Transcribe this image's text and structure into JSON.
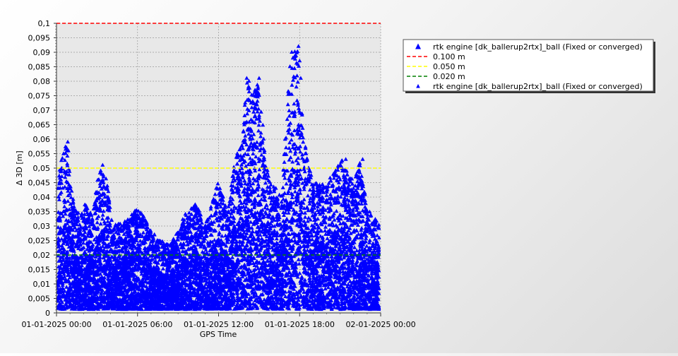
{
  "chart_data": {
    "type": "scatter",
    "xlabel": "GPS Time",
    "ylabel": "Δ 3D [m]",
    "x_range": [
      "2025-01-01T00:00",
      "2025-01-02T00:00"
    ],
    "ylim": [
      0,
      0.1
    ],
    "y_ticks": [
      "0",
      "0,005",
      "0,01",
      "0,015",
      "0,02",
      "0,025",
      "0,03",
      "0,035",
      "0,04",
      "0,045",
      "0,05",
      "0,055",
      "0,06",
      "0,065",
      "0,07",
      "0,075",
      "0,08",
      "0,085",
      "0,09",
      "0,095",
      "0,1"
    ],
    "x_ticks": [
      {
        "value": "2025-01-01T00:00",
        "label": "01-01-2025 00:00"
      },
      {
        "value": "2025-01-01T06:00",
        "label": "01-01-2025 06:00"
      },
      {
        "value": "2025-01-01T12:00",
        "label": "01-01-2025 12:00"
      },
      {
        "value": "2025-01-01T18:00",
        "label": "01-01-2025 18:00"
      },
      {
        "value": "2025-01-02T00:00",
        "label": "02-01-2025 00:00"
      }
    ],
    "grid": true,
    "legend_position": "right",
    "reference_lines": [
      {
        "name": "0.100 m",
        "y": 0.1,
        "color": "#ff0000",
        "style": "dashed"
      },
      {
        "name": "0.050 m",
        "y": 0.05,
        "color": "#ffff00",
        "style": "dashed"
      },
      {
        "name": "0.020 m",
        "y": 0.02,
        "color": "#008000",
        "style": "dashed"
      }
    ],
    "series": [
      {
        "name": "rtk engine [dk_ballerup2rtx]_ball (Fixed or converged)",
        "color": "#0000ff",
        "marker": "triangle",
        "envelope": [
          {
            "x": "2025-01-01T00:00",
            "y": 0.04
          },
          {
            "x": "2025-01-01T00:10",
            "y": 0.047
          },
          {
            "x": "2025-01-01T00:25",
            "y": 0.056
          },
          {
            "x": "2025-01-01T00:50",
            "y": 0.059
          },
          {
            "x": "2025-01-01T01:10",
            "y": 0.04
          },
          {
            "x": "2025-01-01T01:40",
            "y": 0.034
          },
          {
            "x": "2025-01-01T02:10",
            "y": 0.038
          },
          {
            "x": "2025-01-01T02:40",
            "y": 0.033
          },
          {
            "x": "2025-01-01T03:00",
            "y": 0.046
          },
          {
            "x": "2025-01-01T03:25",
            "y": 0.051
          },
          {
            "x": "2025-01-01T03:45",
            "y": 0.045
          },
          {
            "x": "2025-01-01T04:10",
            "y": 0.03
          },
          {
            "x": "2025-01-01T05:00",
            "y": 0.032
          },
          {
            "x": "2025-01-01T06:00",
            "y": 0.036
          },
          {
            "x": "2025-01-01T06:40",
            "y": 0.032
          },
          {
            "x": "2025-01-01T07:30",
            "y": 0.025
          },
          {
            "x": "2025-01-01T08:30",
            "y": 0.024
          },
          {
            "x": "2025-01-01T09:30",
            "y": 0.034
          },
          {
            "x": "2025-01-01T10:20",
            "y": 0.038
          },
          {
            "x": "2025-01-01T11:00",
            "y": 0.03
          },
          {
            "x": "2025-01-01T12:00",
            "y": 0.046
          },
          {
            "x": "2025-01-01T12:40",
            "y": 0.035
          },
          {
            "x": "2025-01-01T13:10",
            "y": 0.052
          },
          {
            "x": "2025-01-01T13:45",
            "y": 0.06
          },
          {
            "x": "2025-01-01T14:05",
            "y": 0.081
          },
          {
            "x": "2025-01-01T14:30",
            "y": 0.075
          },
          {
            "x": "2025-01-01T15:00",
            "y": 0.081
          },
          {
            "x": "2025-01-01T15:30",
            "y": 0.052
          },
          {
            "x": "2025-01-01T16:00",
            "y": 0.044
          },
          {
            "x": "2025-01-01T16:40",
            "y": 0.042
          },
          {
            "x": "2025-01-01T17:20",
            "y": 0.09
          },
          {
            "x": "2025-01-01T17:50",
            "y": 0.092
          },
          {
            "x": "2025-01-01T18:20",
            "y": 0.06
          },
          {
            "x": "2025-01-01T19:00",
            "y": 0.045
          },
          {
            "x": "2025-01-01T20:00",
            "y": 0.045
          },
          {
            "x": "2025-01-01T21:10",
            "y": 0.053
          },
          {
            "x": "2025-01-01T22:00",
            "y": 0.045
          },
          {
            "x": "2025-01-01T22:30",
            "y": 0.053
          },
          {
            "x": "2025-01-01T23:00",
            "y": 0.036
          },
          {
            "x": "2025-01-01T23:30",
            "y": 0.033
          },
          {
            "x": "2025-01-02T00:00",
            "y": 0.03
          }
        ],
        "peaks": [
          {
            "x": "2025-01-01T00:50",
            "y": 0.059
          },
          {
            "x": "2025-01-01T03:25",
            "y": 0.051
          },
          {
            "x": "2025-01-01T14:05",
            "y": 0.081
          },
          {
            "x": "2025-01-01T14:15",
            "y": 0.08
          },
          {
            "x": "2025-01-01T15:00",
            "y": 0.081
          },
          {
            "x": "2025-01-01T17:25",
            "y": 0.09
          },
          {
            "x": "2025-01-01T17:30",
            "y": 0.088
          },
          {
            "x": "2025-01-01T17:55",
            "y": 0.092
          },
          {
            "x": "2025-01-01T18:00",
            "y": 0.087
          },
          {
            "x": "2025-01-01T18:05",
            "y": 0.081
          },
          {
            "x": "2025-01-01T21:25",
            "y": 0.053
          },
          {
            "x": "2025-01-01T22:40",
            "y": 0.053
          }
        ]
      }
    ],
    "legend": [
      {
        "label": "rtk engine [dk_ballerup2rtx]_ball (Fixed or converged)",
        "kind": "marker",
        "color": "#0000ff"
      },
      {
        "label": "0.100 m",
        "kind": "line",
        "color": "#ff0000"
      },
      {
        "label": "0.050 m",
        "kind": "line",
        "color": "#ffff00"
      },
      {
        "label": "0.020 m",
        "kind": "line",
        "color": "#008000"
      },
      {
        "label": "rtk engine [dk_ballerup2rtx]_ball (Fixed or converged)",
        "kind": "marker-small",
        "color": "#0000ff"
      }
    ]
  }
}
